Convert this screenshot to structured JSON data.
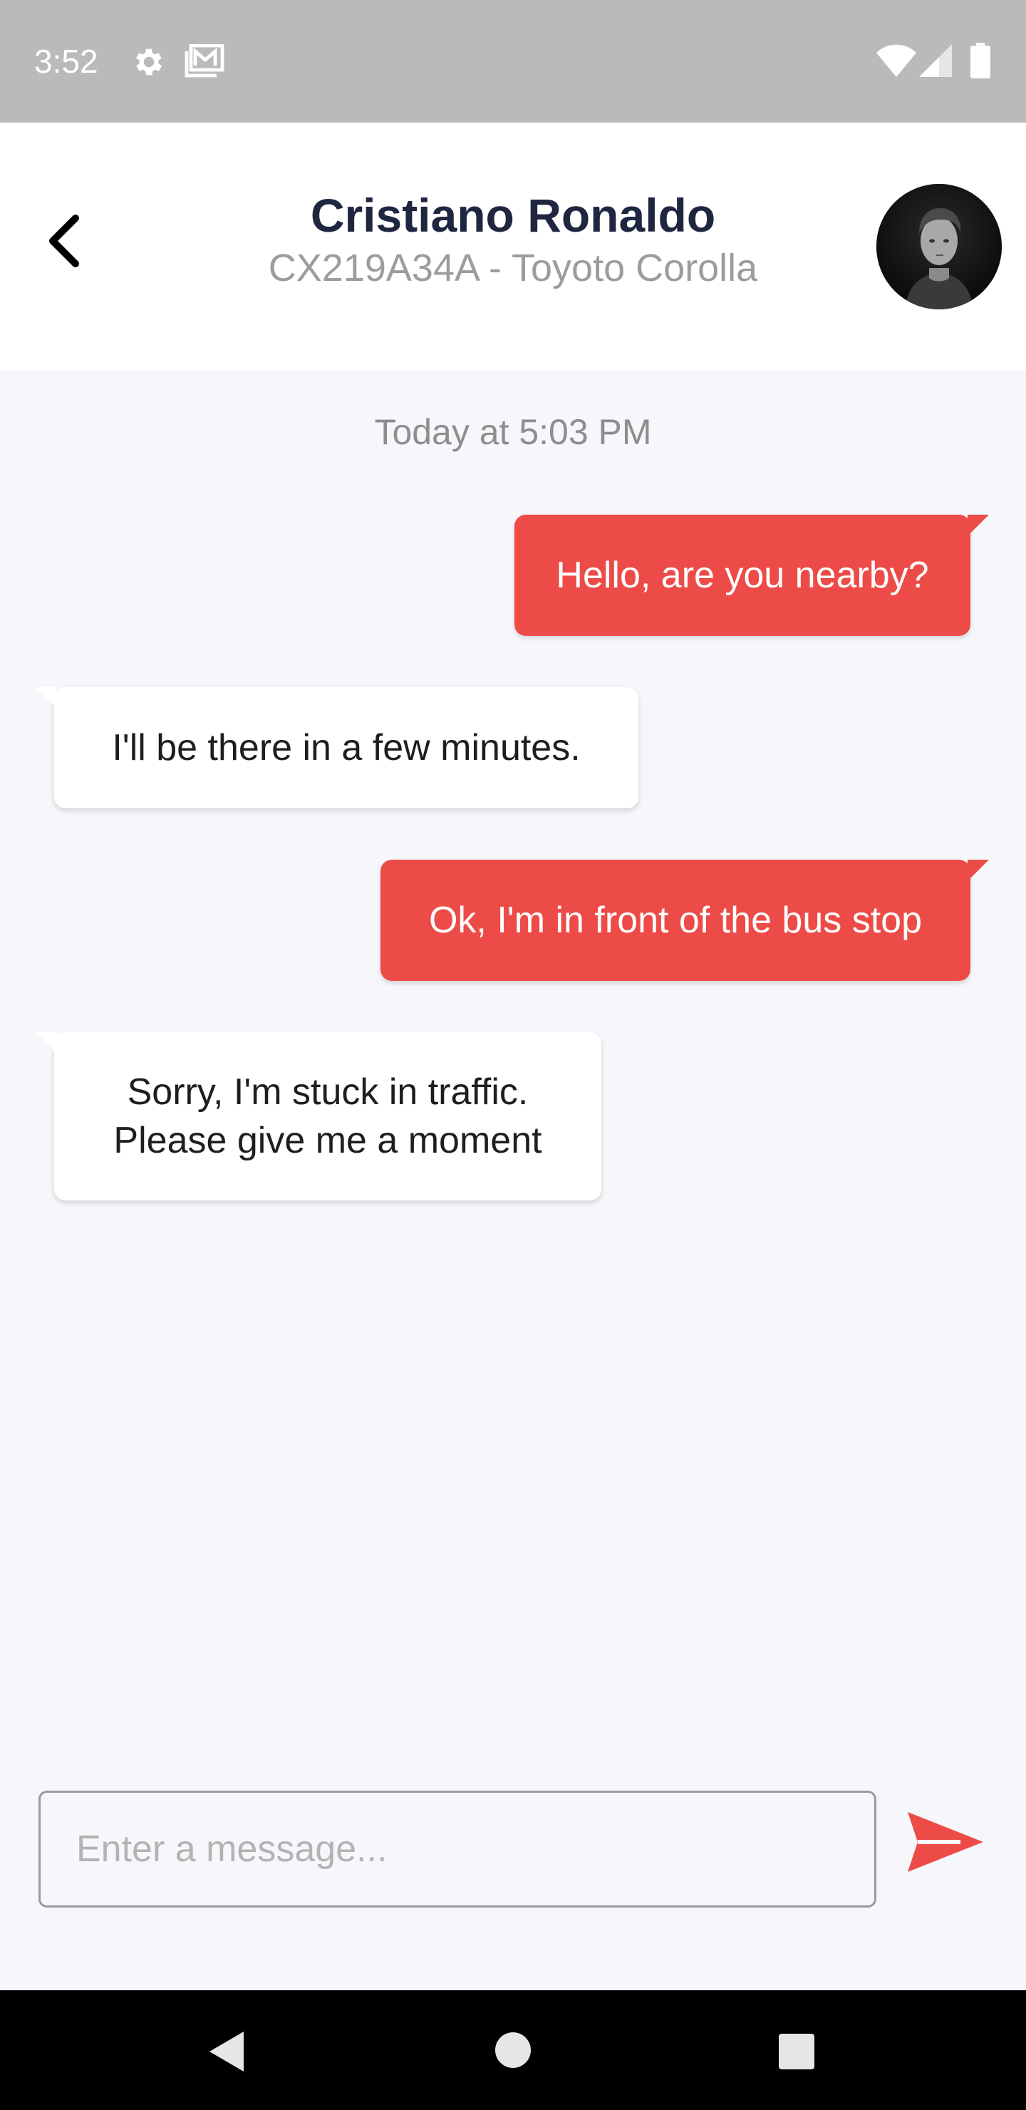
{
  "status_bar": {
    "time": "3:52",
    "icons": [
      "gear-icon",
      "mail-icon",
      "wifi-icon",
      "cell-signal-icon",
      "battery-icon"
    ]
  },
  "header": {
    "back_icon": "chevron-left-icon",
    "driver_name": "Cristiano Ronaldo",
    "vehicle_info": "CX219A34A - Toyoto Corolla",
    "avatar": "driver-avatar"
  },
  "chat": {
    "timestamp": "Today at 5:03 PM",
    "messages": [
      {
        "direction": "outgoing",
        "text": "Hello, are you nearby?"
      },
      {
        "direction": "incoming",
        "text": "I'll be there in a few minutes."
      },
      {
        "direction": "outgoing",
        "text": "Ok, I'm in front of the bus stop"
      },
      {
        "direction": "incoming",
        "text": "Sorry, I'm stuck in traffic.\n Please give me a moment"
      }
    ]
  },
  "composer": {
    "placeholder": "Enter a message...",
    "value": "",
    "send_icon": "send-icon"
  },
  "nav_bar": {
    "icons": [
      "nav-back-icon",
      "nav-home-icon",
      "nav-recents-icon"
    ]
  },
  "colors": {
    "accent": "#ed4b47",
    "status_bar": "#b9babc",
    "background": "#f6f7fb",
    "title": "#1f2640",
    "subtitle": "#9c9c9c"
  }
}
